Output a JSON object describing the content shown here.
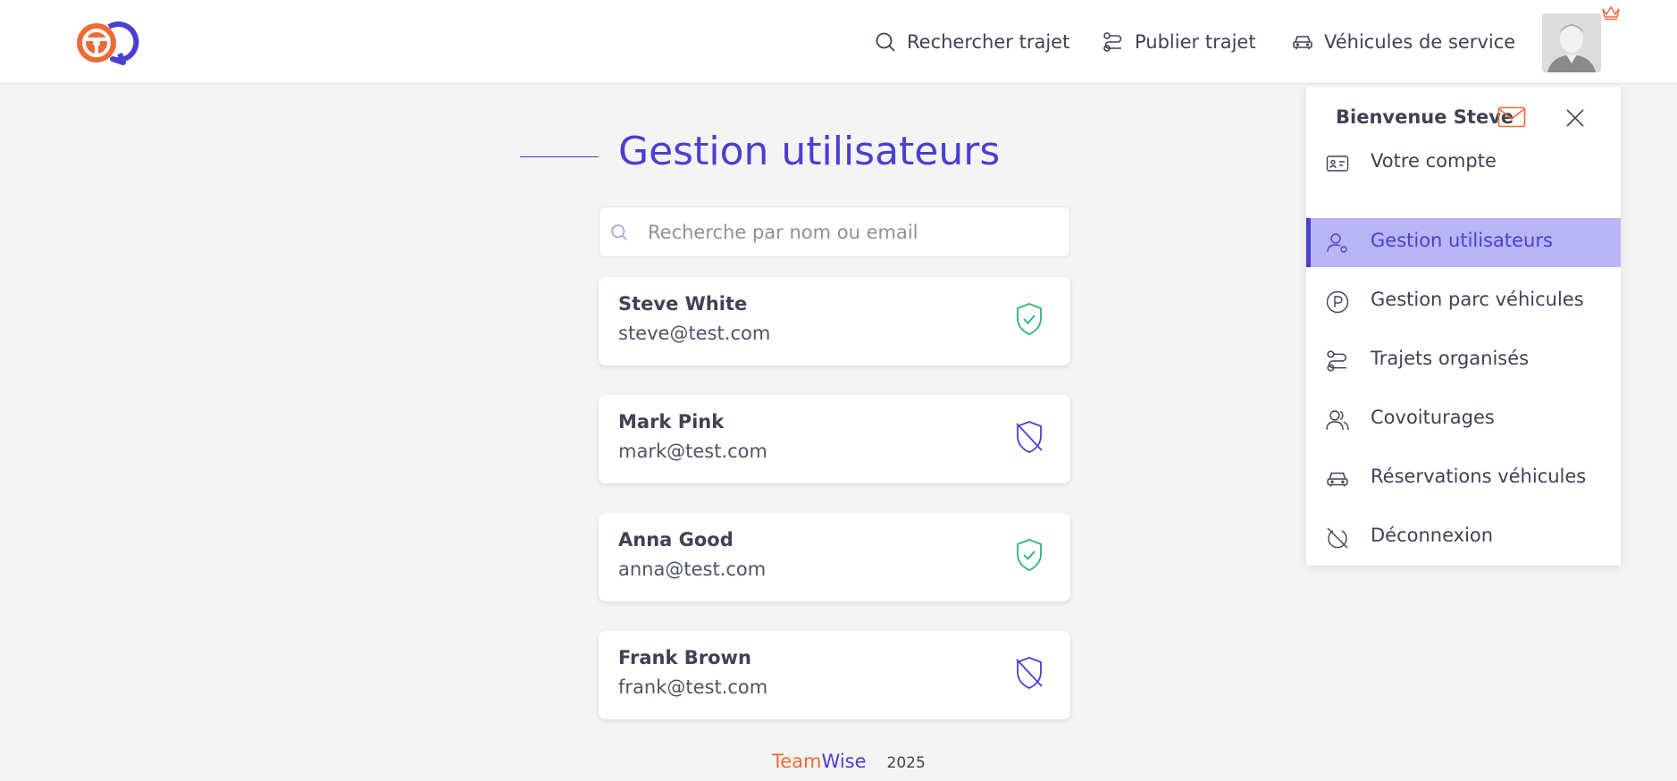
{
  "colors": {
    "brand_primary": "#4a3fd1",
    "brand_orange": "#ef6a36",
    "verified_green": "#2bb673",
    "active_bg": "#b9b6f6"
  },
  "header": {
    "logo_icon": "steering-wheel-chat-logo",
    "nav": [
      {
        "label": "Rechercher trajet",
        "icon": "search-icon"
      },
      {
        "label": "Publier trajet",
        "icon": "route-icon"
      },
      {
        "label": "Véhicules de service",
        "icon": "car-icon"
      }
    ],
    "avatar_icon": "user-avatar",
    "badge_icon": "crown-icon"
  },
  "main": {
    "title": "Gestion utilisateurs",
    "search": {
      "placeholder": "Recherche par nom ou email",
      "value": ""
    },
    "users": [
      {
        "name": "Steve White",
        "email": "steve@test.com",
        "status_icon": "shield-check-icon"
      },
      {
        "name": "Mark Pink",
        "email": "mark@test.com",
        "status_icon": "shield-off-icon"
      },
      {
        "name": "Anna Good",
        "email": "anna@test.com",
        "status_icon": "shield-check-icon"
      },
      {
        "name": "Frank Brown",
        "email": "frank@test.com",
        "status_icon": "shield-off-icon"
      }
    ]
  },
  "footer": {
    "brand_part1": "Team",
    "brand_part2": "Wise",
    "year": "2025"
  },
  "dropdown": {
    "welcome": "Bienvenue Steve",
    "items": [
      {
        "label": "Votre compte",
        "icon": "id-card-icon"
      },
      {
        "label": "Gestion utilisateurs",
        "icon": "user-gear-icon",
        "active": true
      },
      {
        "label": "Gestion parc véhicules",
        "icon": "parking-icon"
      },
      {
        "label": "Trajets organisés",
        "icon": "route-icon"
      },
      {
        "label": "Covoiturages",
        "icon": "users-icon"
      },
      {
        "label": "Réservations véhicules",
        "icon": "car-icon"
      },
      {
        "label": "Déconnexion",
        "icon": "logout-icon"
      }
    ]
  }
}
